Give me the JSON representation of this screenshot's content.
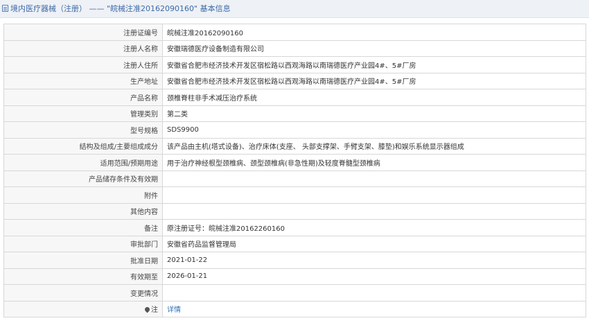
{
  "header": {
    "title": "境内医疗器械（注册） —— \"皖械注准20162090160\" 基本信息"
  },
  "rows": [
    {
      "label": "注册证编号",
      "value": "皖械注准20162090160"
    },
    {
      "label": "注册人名称",
      "value": "安徽瑞德医疗设备制造有限公司"
    },
    {
      "label": "注册人住所",
      "value": "安徽省合肥市经济技术开发区宿松路以西观海路以南瑞德医疗产业园4#、5#厂房"
    },
    {
      "label": "生产地址",
      "value": "安徽省合肥市经济技术开发区宿松路以西观海路以南瑞德医疗产业园4#、5#厂房"
    },
    {
      "label": "产品名称",
      "value": "颈椎脊柱非手术减压治疗系统"
    },
    {
      "label": "管理类别",
      "value": "第二类"
    },
    {
      "label": "型号规格",
      "value": "SDS9900"
    },
    {
      "label": "结构及组成/主要组成成分",
      "value": "该产品由主机(塔式设备)、治疗床体(支座、 头部支撑架、手臂支架、膝垫)和娱乐系统显示器组成"
    },
    {
      "label": "适用范围/预期用途",
      "value": "用于治疗神经根型颈椎病、颈型颈椎病(非急性期)及轻度脊髓型颈椎病"
    },
    {
      "label": "产品储存条件及有效期",
      "value": ""
    },
    {
      "label": "附件",
      "value": ""
    },
    {
      "label": "其他内容",
      "value": ""
    },
    {
      "label": "备注",
      "value": "原注册证号：皖械注准20162260160"
    },
    {
      "label": "审批部门",
      "value": "安徽省药品监督管理局"
    },
    {
      "label": "批准日期",
      "value": "2021-01-22"
    },
    {
      "label": "有效期至",
      "value": "2026-01-21"
    },
    {
      "label": "变更情况",
      "value": ""
    }
  ],
  "note": {
    "label": "注",
    "icon": "pin-icon",
    "link": "详情"
  }
}
